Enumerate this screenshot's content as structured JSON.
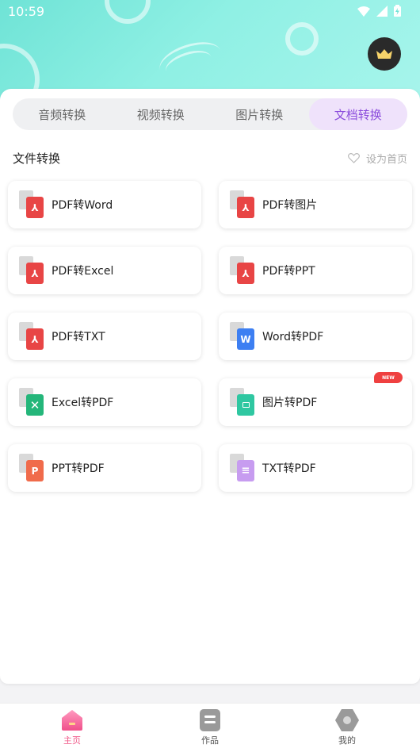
{
  "status": {
    "time": "10:59"
  },
  "colors": {
    "accent": "#8a4bdc",
    "tab_active_bg": "#efe2fb",
    "pdf_red": "#e84545",
    "word_blue": "#3d7ff2",
    "excel_green": "#24b67a",
    "image_teal": "#2fc7a1",
    "ppt_orange": "#f06b4b",
    "txt_purple": "#c79cf0",
    "nav_active": "#f05a8a"
  },
  "header": {
    "crown_icon": "crown-icon"
  },
  "tabs": [
    {
      "label": "音频转换",
      "active": false
    },
    {
      "label": "视频转换",
      "active": false
    },
    {
      "label": "图片转换",
      "active": false
    },
    {
      "label": "文档转换",
      "active": true
    }
  ],
  "section": {
    "title": "文件转换",
    "favorite_label": "设为首页"
  },
  "tools": [
    {
      "label": "PDF转Word",
      "icon": "pdf-icon",
      "badge": ""
    },
    {
      "label": "PDF转图片",
      "icon": "pdf-icon",
      "badge": ""
    },
    {
      "label": "PDF转Excel",
      "icon": "pdf-icon",
      "badge": ""
    },
    {
      "label": "PDF转PPT",
      "icon": "pdf-icon",
      "badge": ""
    },
    {
      "label": "PDF转TXT",
      "icon": "pdf-icon",
      "badge": ""
    },
    {
      "label": "Word转PDF",
      "icon": "word-icon",
      "badge": ""
    },
    {
      "label": "Excel转PDF",
      "icon": "excel-icon",
      "badge": ""
    },
    {
      "label": "图片转PDF",
      "icon": "image-icon",
      "badge": "NEW"
    },
    {
      "label": "PPT转PDF",
      "icon": "ppt-icon",
      "badge": ""
    },
    {
      "label": "TXT转PDF",
      "icon": "txt-icon",
      "badge": ""
    }
  ],
  "nav": [
    {
      "label": "主页",
      "active": true
    },
    {
      "label": "作品",
      "active": false
    },
    {
      "label": "我的",
      "active": false
    }
  ]
}
